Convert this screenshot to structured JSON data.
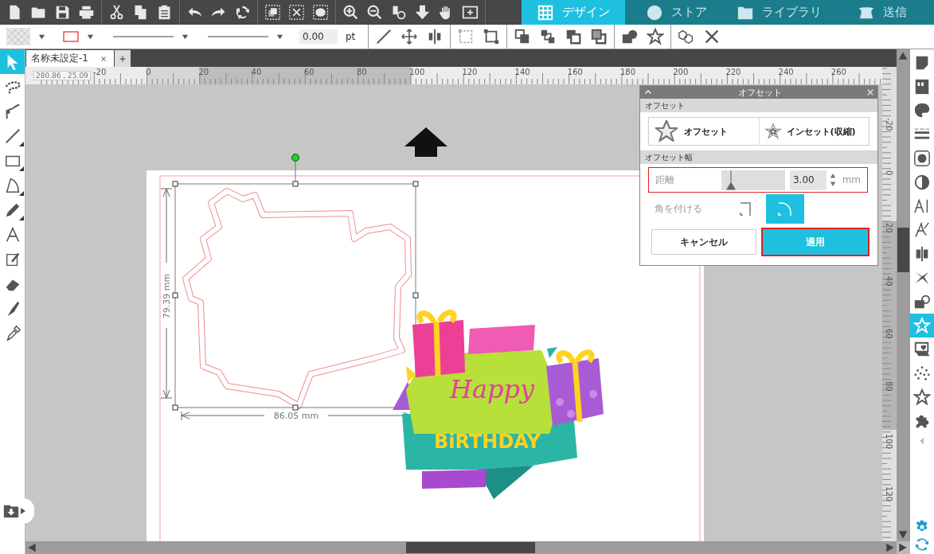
{
  "top_tabs": [
    {
      "label": "デザイン",
      "selected": true
    },
    {
      "label": "ストア",
      "selected": false
    },
    {
      "label": "ライブラリ",
      "selected": false
    },
    {
      "label": "送信",
      "selected": false
    }
  ],
  "line_width": {
    "value": "0.00",
    "unit": "pt"
  },
  "document_tab": {
    "title": "名称未設定-1"
  },
  "coordinates": "280.86 , 25.09",
  "ruler_horizontal": [
    "-20",
    "0",
    "20",
    "40",
    "60",
    "80",
    "100",
    "120",
    "140",
    "160",
    "180",
    "200",
    "220",
    "240",
    "260"
  ],
  "ruler_vertical": [
    "-20",
    "0",
    "20",
    "40",
    "60",
    "80",
    "100",
    "120"
  ],
  "left_tools": [
    {
      "selected": true
    },
    {
      "selected": false
    },
    {
      "selected": false
    },
    {
      "selected": false
    },
    {
      "selected": false
    },
    {
      "selected": false
    },
    {
      "selected": false
    },
    {
      "selected": false
    },
    {
      "selected": false
    },
    {
      "selected": false
    },
    {
      "selected": false
    },
    {
      "selected": false
    }
  ],
  "right_tools": [
    {
      "selected": false
    },
    {
      "selected": false
    },
    {
      "selected": false
    },
    {
      "selected": false
    },
    {
      "selected": false
    },
    {
      "selected": false
    },
    {
      "selected": false
    },
    {
      "selected": false
    },
    {
      "selected": false
    },
    {
      "selected": false
    },
    {
      "selected": false
    },
    {
      "selected": true
    },
    {
      "selected": false
    },
    {
      "selected": false
    },
    {
      "selected": false
    },
    {
      "selected": false
    }
  ],
  "canvas": {
    "height_label": "79.39 mm",
    "width_label": "86.05 mm",
    "art_texts": [
      "Happy",
      "BiRTHDAY"
    ]
  },
  "offset_panel": {
    "title": "オフセット",
    "section_mode": "オフセット",
    "modes": [
      {
        "label": "オフセット",
        "selected": false
      },
      {
        "label": "インセット(収縮)",
        "selected": false
      }
    ],
    "section_width": "オフセット幅",
    "distance": {
      "label": "距離",
      "level": 0.15,
      "value": "3.00",
      "unit": "mm",
      "highlighted": true
    },
    "corner": {
      "label": "角を付ける",
      "options": [
        {
          "selected": false
        },
        {
          "selected": true
        }
      ]
    },
    "buttons": [
      {
        "label": "キャンセル",
        "kind": "secondary",
        "highlighted": false
      },
      {
        "label": "適用",
        "kind": "primary",
        "highlighted": true
      }
    ]
  }
}
